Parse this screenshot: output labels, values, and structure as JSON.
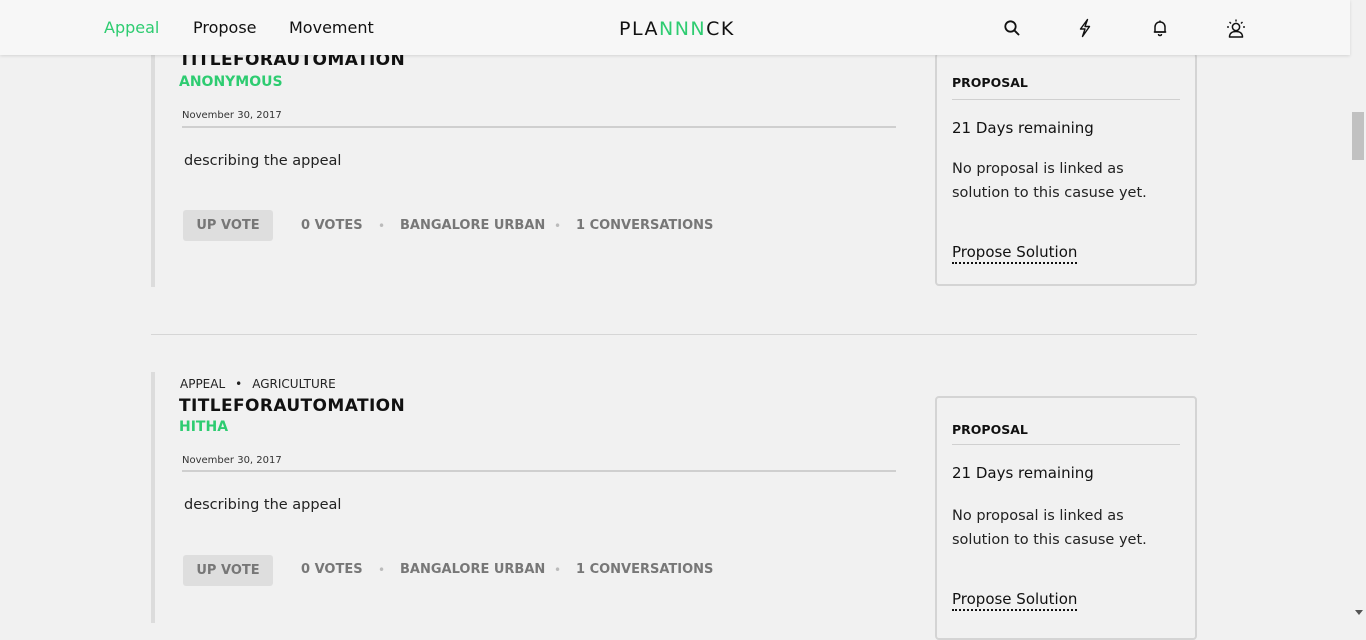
{
  "nav": {
    "links": [
      "Appeal",
      "Propose",
      "Movement"
    ],
    "logo_prefix": "PLA",
    "logo_accent": "NNN",
    "logo_suffix": "CK",
    "icons": [
      "search-icon",
      "lightning-icon",
      "bell-icon",
      "user-profile-icon"
    ],
    "accent_color": "#2ecc71"
  },
  "cards": [
    {
      "type": "",
      "category": "",
      "title": "TITLEFORAUTOMATION",
      "author": "ANONYMOUS",
      "date": "November 30, 2017",
      "description": "describing the appeal",
      "upvote_label": "UP VOTE",
      "votes": "0 VOTES",
      "location": "BANGALORE URBAN",
      "conversations": "1 CONVERSATIONS",
      "proposal": {
        "heading": "PROPOSAL",
        "days": "21 Days remaining",
        "text": "No proposal is linked as solution to this casuse yet.",
        "link": "Propose Solution"
      }
    },
    {
      "type": "APPEAL",
      "category": "AGRICULTURE",
      "title": "TITLEFORAUTOMATION",
      "author": "HITHA",
      "date": "November 30, 2017",
      "description": "describing the appeal",
      "upvote_label": "UP VOTE",
      "votes": "0 VOTES",
      "location": "BANGALORE URBAN",
      "conversations": "1 CONVERSATIONS",
      "proposal": {
        "heading": "PROPOSAL",
        "days": "21 Days remaining",
        "text": "No proposal is linked as solution to this casuse yet.",
        "link": "Propose Solution"
      }
    }
  ]
}
